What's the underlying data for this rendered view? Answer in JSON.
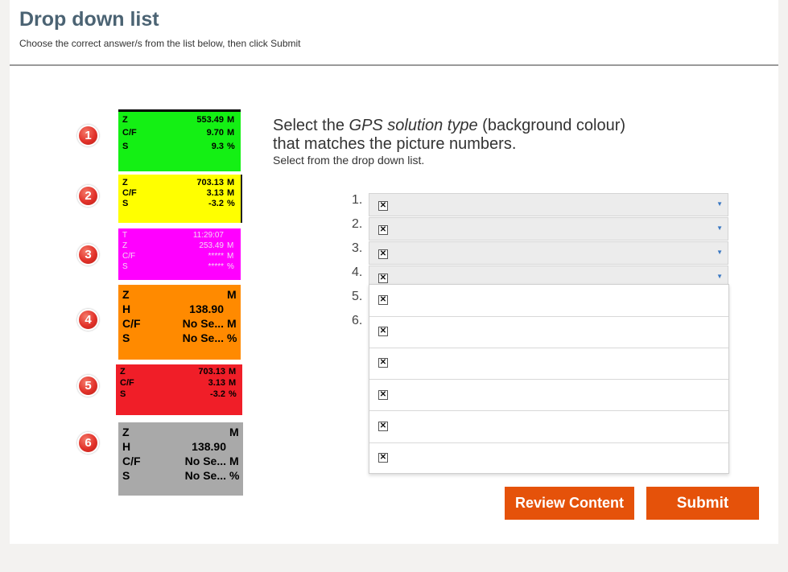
{
  "header": {
    "title": "Drop down list",
    "instructions": "Choose the correct answer/s from the list below, then click Submit"
  },
  "question": {
    "line1_before": "Select the ",
    "line1_emphasis": "GPS solution type",
    "line1_after": " (background colour)",
    "line2": "that matches the picture numbers.",
    "sub": "Select from the drop down list."
  },
  "pictures": [
    {
      "number": "1",
      "color": "#14f014",
      "rows": [
        [
          "Z",
          "553.49",
          "M"
        ],
        [
          "C/F",
          "9.70",
          "M"
        ],
        [
          "S",
          "9.3",
          "%"
        ]
      ]
    },
    {
      "number": "2",
      "color": "#ffff00",
      "rows": [
        [
          "Z",
          "703.13",
          "M"
        ],
        [
          "C/F",
          "3.13",
          "M"
        ],
        [
          "S",
          "-3.2",
          "%"
        ]
      ]
    },
    {
      "number": "3",
      "color": "#ff00ff",
      "rows": [
        [
          "T",
          "11:29:07",
          ""
        ],
        [
          "Z",
          "253.49",
          "M"
        ],
        [
          "C/F",
          "*****",
          "M"
        ],
        [
          "S",
          "*****",
          "%"
        ]
      ]
    },
    {
      "number": "4",
      "color": "#ff8a00",
      "rows": [
        [
          "Z",
          "",
          "M"
        ],
        [
          "H",
          "138.90",
          ""
        ],
        [
          "C/F",
          "No Se...",
          "M"
        ],
        [
          "S",
          "No Se...",
          "%"
        ]
      ]
    },
    {
      "number": "5",
      "color": "#f01e28",
      "rows": [
        [
          "Z",
          "703.13",
          "M"
        ],
        [
          "C/F",
          "3.13",
          "M"
        ],
        [
          "S",
          "-3.2",
          "%"
        ]
      ]
    },
    {
      "number": "6",
      "color": "#a9a9a9",
      "rows": [
        [
          "Z",
          "",
          "M"
        ],
        [
          "H",
          "138.90",
          ""
        ],
        [
          "C/F",
          "No Se...",
          "M"
        ],
        [
          "S",
          "No Se...",
          "%"
        ]
      ]
    }
  ],
  "answer_numbers": [
    "1.",
    "2.",
    "3.",
    "4.",
    "5.",
    "6."
  ],
  "dropdowns": [
    {
      "icon": "broken-image-icon"
    },
    {
      "icon": "broken-image-icon"
    },
    {
      "icon": "broken-image-icon"
    },
    {
      "icon": "broken-image-icon"
    }
  ],
  "open_list_options": [
    {
      "icon": "broken-image-icon"
    },
    {
      "icon": "broken-image-icon"
    },
    {
      "icon": "broken-image-icon"
    },
    {
      "icon": "broken-image-icon"
    },
    {
      "icon": "broken-image-icon"
    },
    {
      "icon": "broken-image-icon"
    }
  ],
  "buttons": {
    "review": "Review Content",
    "submit": "Submit"
  },
  "colors": {
    "accent": "#e5520a",
    "title": "#4b6373",
    "badge": "#e2322a"
  }
}
